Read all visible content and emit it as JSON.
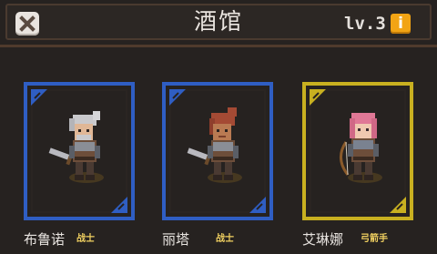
{
  "header": {
    "title": "酒馆",
    "level": "lv.3",
    "info": "i"
  },
  "heroes": [
    {
      "name": "布鲁诺",
      "role": "战士",
      "frame_color": "#2f5ec3"
    },
    {
      "name": "丽塔",
      "role": "战士",
      "frame_color": "#2f5ec3"
    },
    {
      "name": "艾琳娜",
      "role": "弓箭手",
      "frame_color": "#c8b020"
    }
  ],
  "colors": {
    "background": "#262220",
    "header_border": "#4f3a2c",
    "close_button": "#e9e4df",
    "info_button": "#f2a414",
    "role_text": "#f0d060"
  }
}
